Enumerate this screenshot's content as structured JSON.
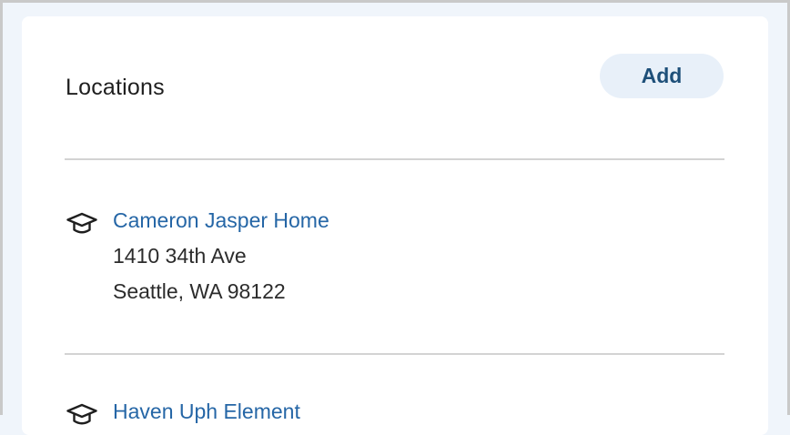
{
  "card": {
    "title": "Locations",
    "add_label": "Add"
  },
  "locations": [
    {
      "name": "Cameron Jasper Home",
      "address_line1": "1410 34th Ave",
      "address_line2": "Seattle, WA 98122",
      "icon": "graduation-cap-icon"
    },
    {
      "name": "Haven Uph Element",
      "icon": "graduation-cap-icon"
    }
  ],
  "colors": {
    "link": "#2566a6",
    "button_bg": "#e8f0f9",
    "button_text": "#1d4f79",
    "page_bg": "#f0f5fb"
  }
}
